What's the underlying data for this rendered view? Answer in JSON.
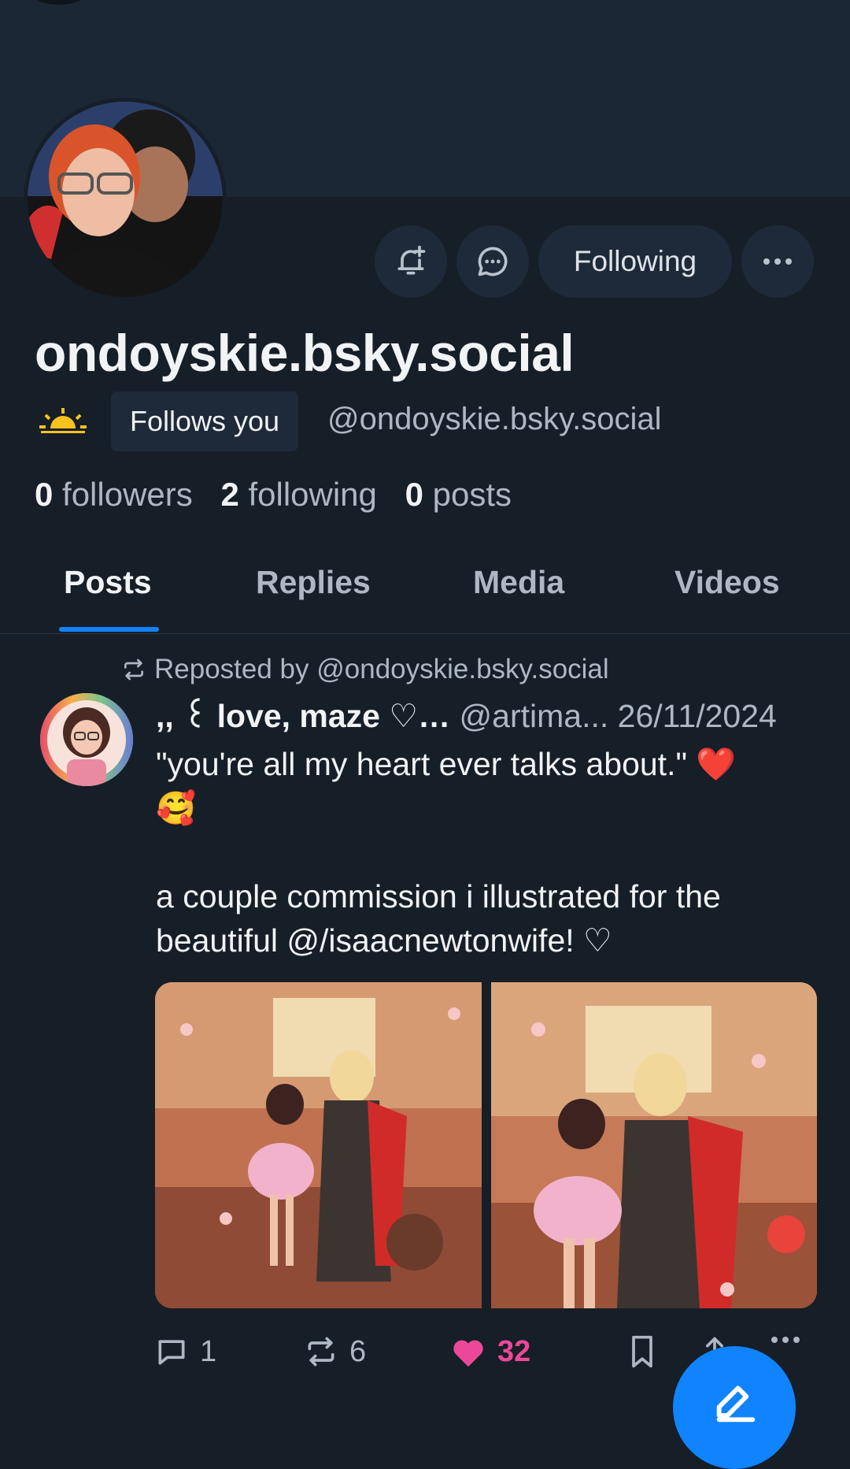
{
  "profile": {
    "display_name": "ondoyskie.bsky.social",
    "follows_you_label": "Follows you",
    "handle": "@ondoyskie.bsky.social",
    "following_button": "Following",
    "stats": {
      "followers_count": "0",
      "followers_label": "followers",
      "following_count": "2",
      "following_label": "following",
      "posts_count": "0",
      "posts_label": "posts"
    }
  },
  "tabs": [
    {
      "label": "Posts",
      "active": true
    },
    {
      "label": "Replies",
      "active": false
    },
    {
      "label": "Media",
      "active": false
    },
    {
      "label": "Videos",
      "active": false
    }
  ],
  "post": {
    "repost_label": "Reposted by @ondoyskie.bsky.social",
    "author_name": ",, ꒰ love, maze ♡…",
    "author_handle": "@artima...",
    "date": "26/11/2024",
    "text_line1": "\"you're all my heart ever talks about.\" ❤️",
    "text_line2": "🥰",
    "text_line3": "a couple commission i illustrated for the beautiful @/isaacnewtonwife! ♡",
    "reply_count": "1",
    "repost_count": "6",
    "like_count": "32"
  },
  "icons": [
    "bell-plus-icon",
    "chat-icon",
    "more-icon",
    "sun-icon",
    "repost-icon",
    "reply-icon",
    "heart-icon",
    "bookmark-icon",
    "share-icon",
    "compose-icon"
  ],
  "colors": {
    "accent": "#1083fe",
    "like": "#ec4899",
    "background": "#161e27"
  }
}
